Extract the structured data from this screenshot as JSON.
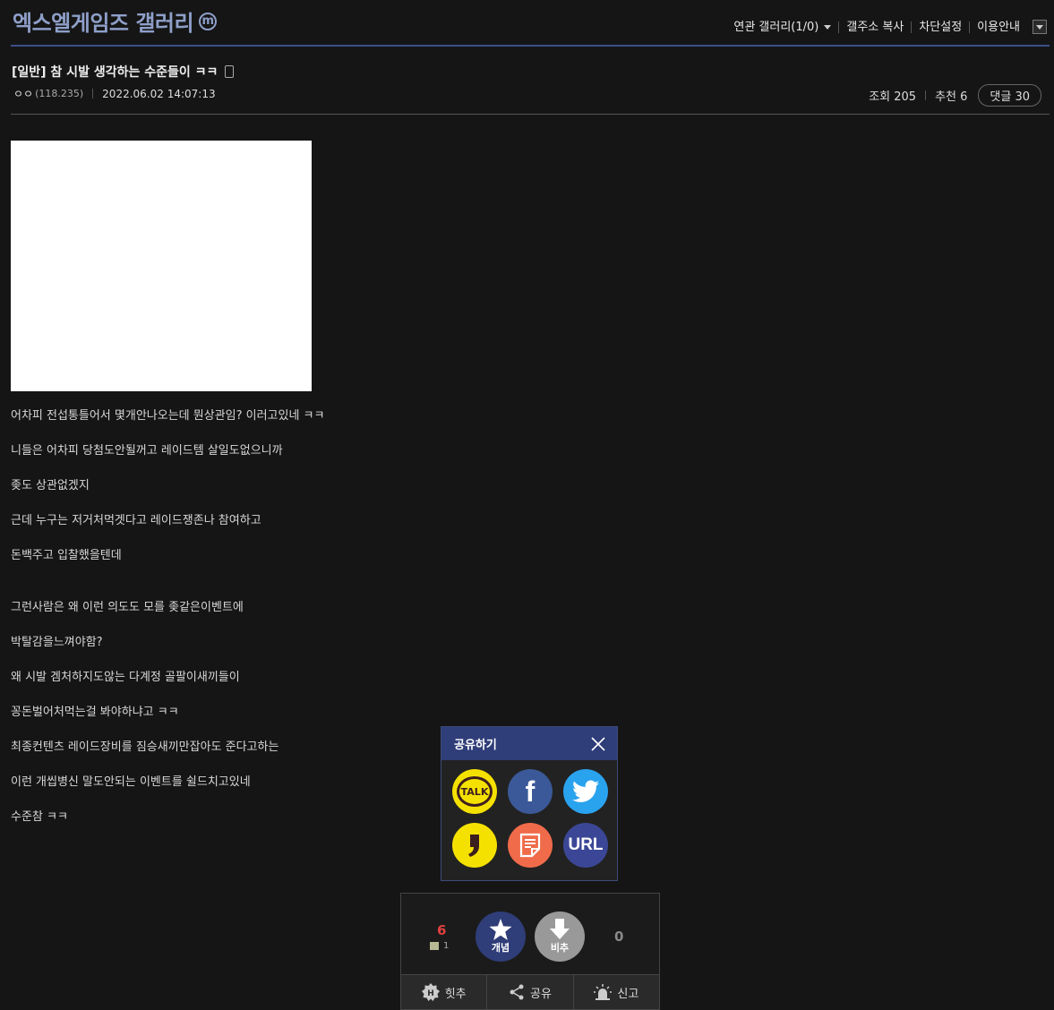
{
  "gallery": {
    "title": "엑스엘게임즈 갤러리",
    "badge": "ⓜ"
  },
  "nav": {
    "related": "연관 갤러리(1/0)",
    "copy_addr": "갤주소 복사",
    "block": "차단설정",
    "guide": "이용안내"
  },
  "post": {
    "title": "[일반] 참 시발 생각하는 수준들이 ㅋㅋ",
    "author": "ㅇㅇ",
    "ip": "(118.235)",
    "date": "2022.06.02 14:07:13",
    "views_label": "조회 205",
    "recommend_label": "추천 6",
    "comments_label": "댓글 30",
    "lines": [
      "어차피 전섭통틀어서 몇개안나오는데 뭔상관임? 이러고있네 ㅋㅋ",
      "니들은 어차피 당첨도안될꺼고 레이드템 살일도없으니까",
      "좆도 상관없겠지",
      "근데 누구는 저거처먹겟다고 레이드쟁존나 참여하고",
      "돈백주고 입찰했을텐데",
      "그런사람은 왜 이런 의도도 모를 좆같은이벤트에",
      "박탈감을느껴야함?",
      "왜 시발 겜처하지도않는 다계정 골팔이새끼들이",
      "꽁돈벌어처먹는걸 봐야하냐고 ㅋㅋ",
      "최종컨텐츠 레이드장비를 짐승새끼만잡아도 준다고하는",
      "이런 개씹병신 말도안되는 이벤트를 쉴드치고있네",
      "수준참 ㅋㅋ"
    ]
  },
  "share": {
    "title": "공유하기",
    "items": [
      {
        "name": "kakao-talk",
        "label": "TALK",
        "color": "#f5e100"
      },
      {
        "name": "facebook",
        "label": "f",
        "color": "#3b5998"
      },
      {
        "name": "twitter",
        "label": "",
        "color": "#2aa3ef"
      },
      {
        "name": "kakao-story",
        "label": "",
        "color": "#f5e100"
      },
      {
        "name": "blog",
        "label": "",
        "color": "#f06b4a"
      },
      {
        "name": "url",
        "label": "URL",
        "color": "#3b4796"
      }
    ]
  },
  "vote": {
    "up_count": "6",
    "fixed_count": "1",
    "up_label": "개념",
    "down_label": "비추",
    "down_count": "0",
    "hit_label": "힛추",
    "share_label": "공유",
    "report_label": "신고"
  }
}
